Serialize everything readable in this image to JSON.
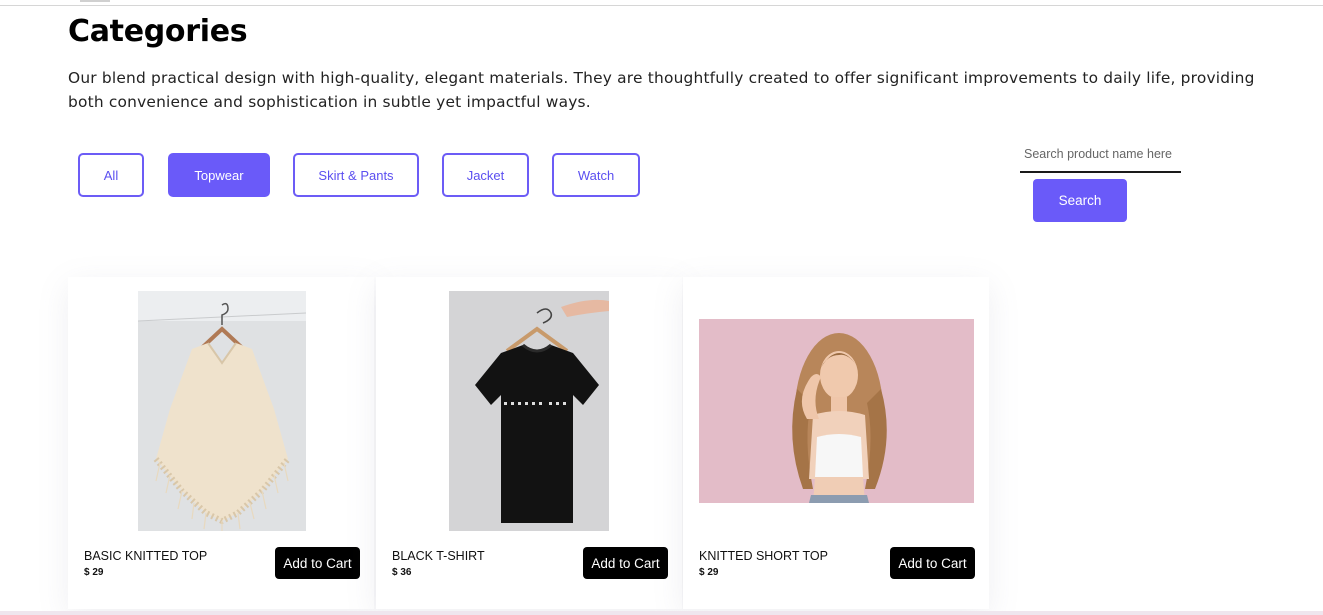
{
  "page": {
    "title": "Categories",
    "description": "Our blend practical design with high-quality, elegant materials. They are thoughtfully created to offer significant improvements to daily life, providing both convenience and sophistication in subtle yet impactful ways."
  },
  "filters": [
    {
      "label": "All",
      "active": false
    },
    {
      "label": "Topwear",
      "active": true
    },
    {
      "label": "Skirt & Pants",
      "active": false
    },
    {
      "label": "Jacket",
      "active": false
    },
    {
      "label": "Watch",
      "active": false
    }
  ],
  "search": {
    "placeholder": "Search product name here",
    "button_label": "Search"
  },
  "products": [
    {
      "name": "BASIC KNITTED TOP",
      "price": "$ 29",
      "cart_label": "Add to Cart",
      "image": "knitted-poncho-on-hanger"
    },
    {
      "name": "BLACK T-SHIRT",
      "price": "$ 36",
      "cart_label": "Add to Cart",
      "image": "black-tshirt-on-hanger"
    },
    {
      "name": "KNITTED SHORT TOP",
      "price": "$ 29",
      "cart_label": "Add to Cart",
      "image": "woman-pink-background"
    }
  ],
  "colors": {
    "accent": "#6a5af9",
    "cart_button": "#000000"
  }
}
